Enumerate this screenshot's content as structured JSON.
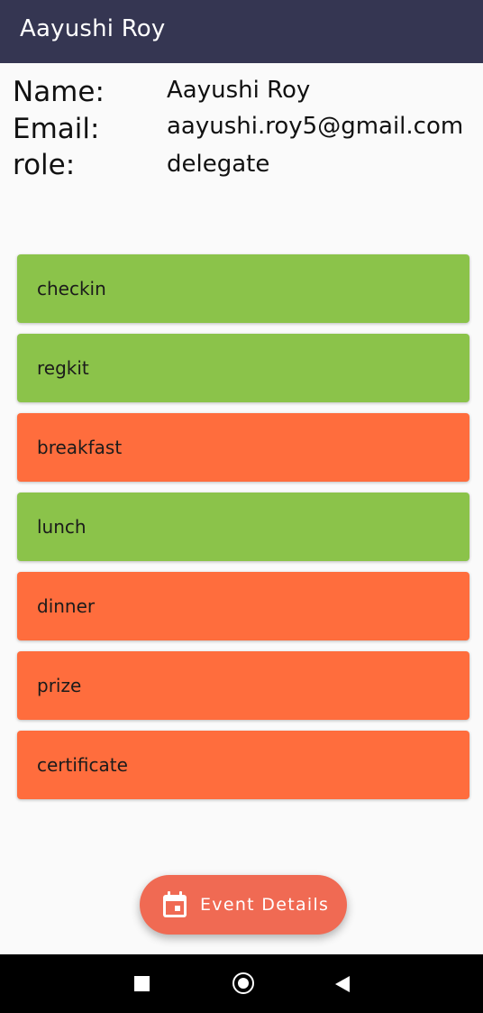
{
  "app_bar": {
    "title": "Aayushi Roy"
  },
  "profile": {
    "name_label": "Name:",
    "name_value": "Aayushi Roy",
    "email_label": "Email:",
    "email_value": "aayushi.roy5@gmail.com",
    "role_label": "role:",
    "role_value": "delegate"
  },
  "items": [
    {
      "label": "checkin",
      "status": "done"
    },
    {
      "label": "regkit",
      "status": "done"
    },
    {
      "label": "breakfast",
      "status": "pending"
    },
    {
      "label": "lunch",
      "status": "done"
    },
    {
      "label": "dinner",
      "status": "pending"
    },
    {
      "label": "prize",
      "status": "pending"
    },
    {
      "label": "certificate",
      "status": "pending"
    }
  ],
  "colors": {
    "app_bar": "#353652",
    "done": "#8bc34a",
    "pending": "#ff6d3d",
    "fab": "#f06a53"
  },
  "fab": {
    "label": "Event Details",
    "icon": "calendar-icon"
  },
  "nav": {
    "icons": [
      "recents-icon",
      "home-icon",
      "back-icon"
    ]
  }
}
